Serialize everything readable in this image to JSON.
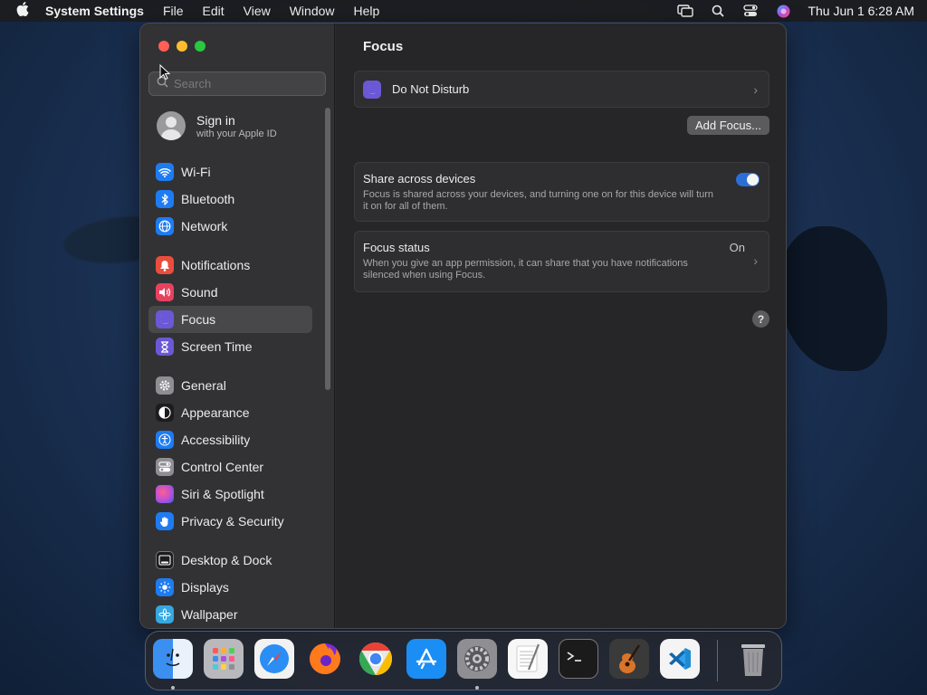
{
  "menubar": {
    "app_name": "System Settings",
    "menus": [
      "File",
      "Edit",
      "View",
      "Window",
      "Help"
    ],
    "datetime": "Thu Jun 1  6:28 AM"
  },
  "sidebar": {
    "search_placeholder": "Search",
    "account": {
      "title": "Sign in",
      "subtitle": "with your Apple ID"
    },
    "groups": [
      [
        {
          "label": "Wi-Fi",
          "icon": "wifi-icon",
          "color": "#1e7cf2"
        },
        {
          "label": "Bluetooth",
          "icon": "bluetooth-icon",
          "color": "#1e7cf2"
        },
        {
          "label": "Network",
          "icon": "globe-icon",
          "color": "#1e7cf2"
        }
      ],
      [
        {
          "label": "Notifications",
          "icon": "bell-icon",
          "color": "#eb4d3d"
        },
        {
          "label": "Sound",
          "icon": "speaker-icon",
          "color": "#e8415f"
        },
        {
          "label": "Focus",
          "icon": "moon-icon",
          "color": "#6b58d6",
          "selected": true
        },
        {
          "label": "Screen Time",
          "icon": "hourglass-icon",
          "color": "#6b58d6"
        }
      ],
      [
        {
          "label": "General",
          "icon": "gear-icon",
          "color": "#8e8e93"
        },
        {
          "label": "Appearance",
          "icon": "appearance-icon",
          "color": "#1c1c1e"
        },
        {
          "label": "Accessibility",
          "icon": "accessibility-icon",
          "color": "#1e7cf2"
        },
        {
          "label": "Control Center",
          "icon": "control-center-icon",
          "color": "#8e8e93"
        },
        {
          "label": "Siri & Spotlight",
          "icon": "siri-icon",
          "color": "#b94fd8"
        },
        {
          "label": "Privacy & Security",
          "icon": "hand-icon",
          "color": "#1e7cf2"
        }
      ],
      [
        {
          "label": "Desktop & Dock",
          "icon": "dock-icon",
          "color": "#1c1c1e"
        },
        {
          "label": "Displays",
          "icon": "sun-icon",
          "color": "#1e7cf2"
        },
        {
          "label": "Wallpaper",
          "icon": "flower-icon",
          "color": "#35a8e0"
        }
      ]
    ]
  },
  "main": {
    "title": "Focus",
    "dnd_label": "Do Not Disturb",
    "add_focus_label": "Add Focus...",
    "share": {
      "title": "Share across devices",
      "description": "Focus is shared across your devices, and turning one on for this device will turn it on for all of them.",
      "enabled": true
    },
    "status": {
      "title": "Focus status",
      "value": "On",
      "description": "When you give an app permission, it can share that you have notifications silenced when using Focus."
    },
    "help_label": "?"
  },
  "dock": {
    "apps": [
      {
        "name": "finder",
        "color": "#3a8ff0",
        "glyph": "☺"
      },
      {
        "name": "launchpad",
        "color": "#b9b9bd",
        "glyph": "▦"
      },
      {
        "name": "safari",
        "color": "#2a8ef5",
        "glyph": "✧"
      },
      {
        "name": "firefox",
        "color": "#e8602a",
        "glyph": "◉"
      },
      {
        "name": "chrome",
        "color": "#e7e7e7",
        "glyph": "◎"
      },
      {
        "name": "app-store",
        "color": "#1a8ef5",
        "glyph": "A"
      },
      {
        "name": "system-settings",
        "color": "#8f8f93",
        "glyph": "⚙"
      },
      {
        "name": "textedit",
        "color": "#f1f1f1",
        "glyph": "✎"
      },
      {
        "name": "terminal",
        "color": "#1b1b1b",
        "glyph": ">_"
      },
      {
        "name": "garageband",
        "color": "#3a3a3a",
        "glyph": "♫"
      },
      {
        "name": "vscode",
        "color": "#f4f4f4",
        "glyph": "⟩"
      },
      {
        "name": "trash",
        "color": "#8d8d90",
        "glyph": "🗑"
      }
    ]
  }
}
